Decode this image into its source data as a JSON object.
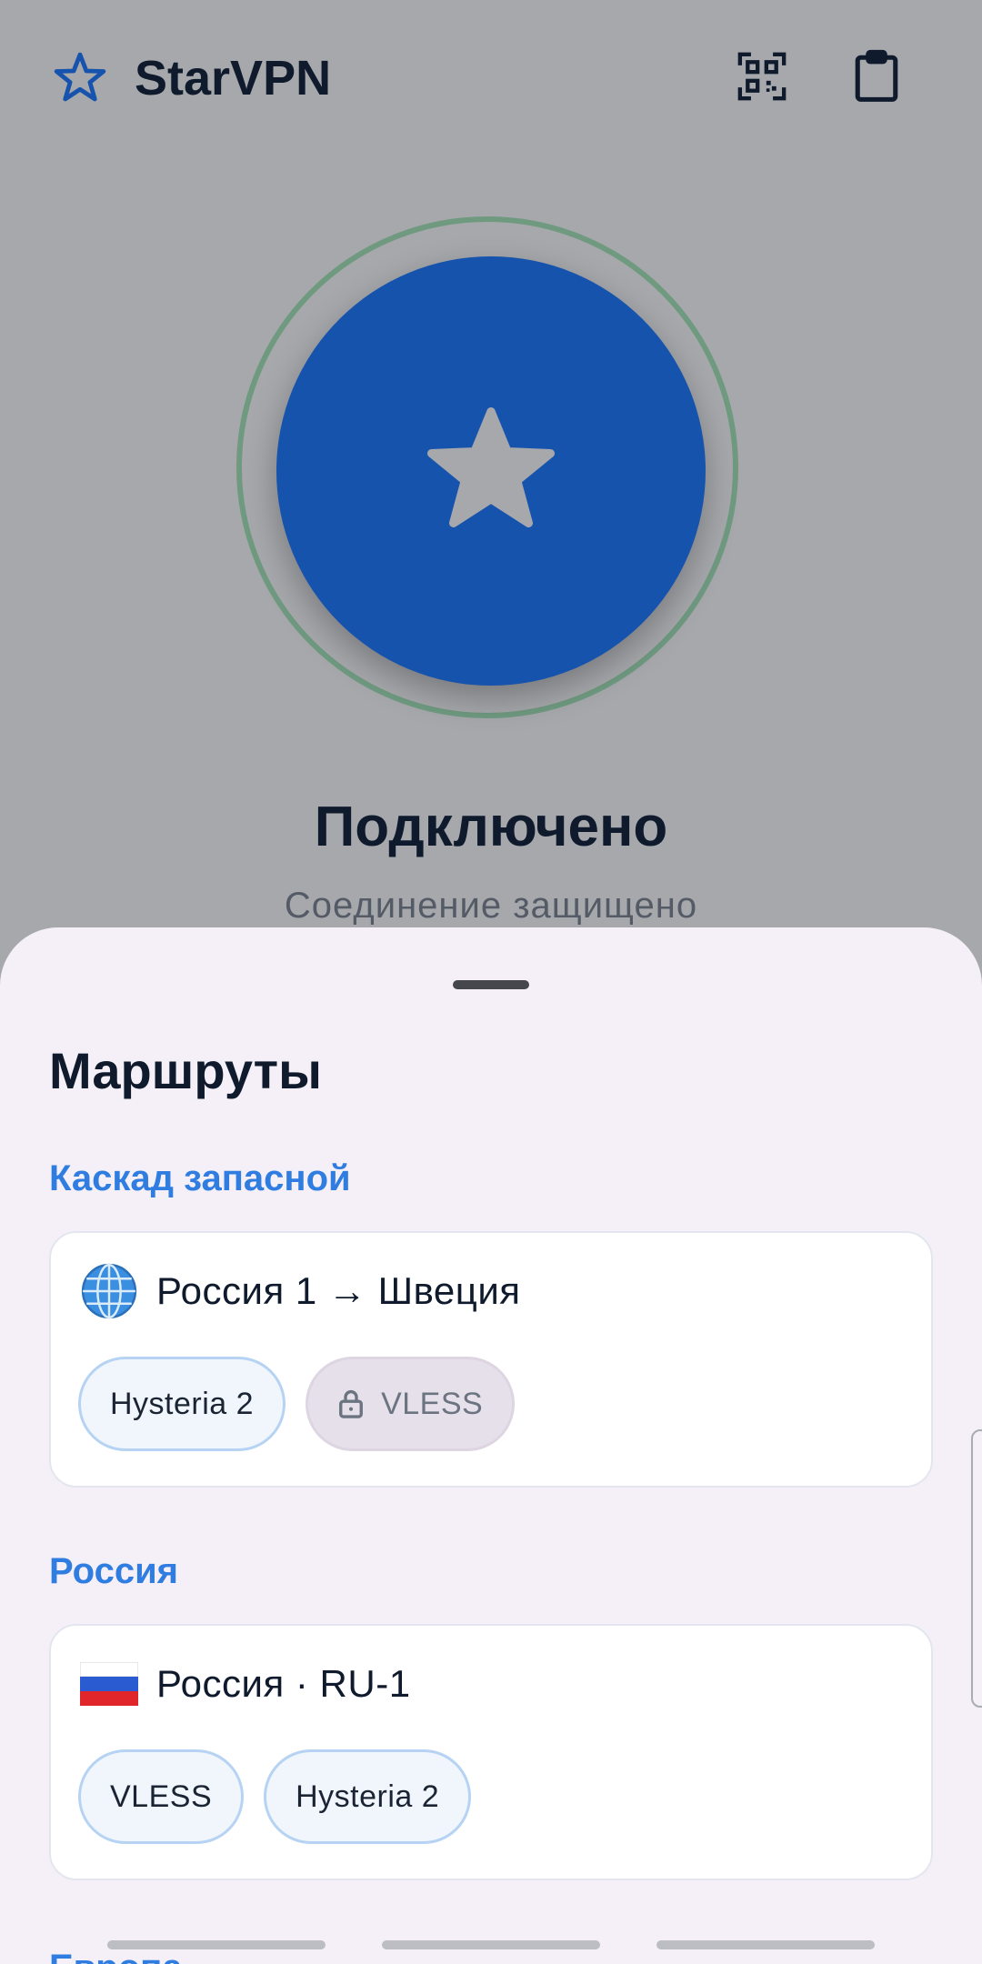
{
  "header": {
    "app_title": "StarVPN",
    "logo_icon": "star-outline-icon",
    "qr_icon": "qr-code-scan-icon",
    "clipboard_icon": "clipboard-icon"
  },
  "connection": {
    "status": "Подключено",
    "subtitle": "Соединение защищено",
    "button_icon": "star-icon",
    "state_color": "#1653ad",
    "ring_color": "#6f9a80"
  },
  "routes": {
    "title": "Маршруты",
    "groups": [
      {
        "label": "Каскад запасной",
        "card": {
          "icon": "globe-icon",
          "title": "Россия 1 → Швеция",
          "chips": [
            {
              "label": "Hysteria 2",
              "locked": false
            },
            {
              "label": "VLESS",
              "locked": true
            }
          ]
        }
      },
      {
        "label": "Россия",
        "card": {
          "icon": "flag-russia-icon",
          "title": "Россия · RU-1",
          "chips": [
            {
              "label": "VLESS",
              "locked": false
            },
            {
              "label": "Hysteria 2",
              "locked": false
            }
          ]
        }
      },
      {
        "label": "Европа"
      }
    ]
  },
  "colors": {
    "accent": "#2f7de0",
    "scrim": "#a6a8ac",
    "sheet_bg": "#f5f0f7"
  }
}
